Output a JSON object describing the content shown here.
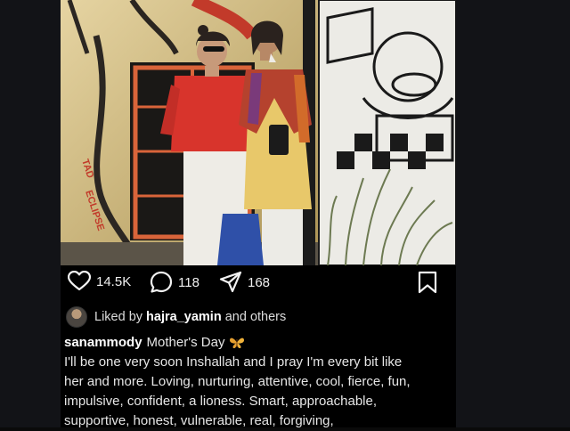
{
  "post": {
    "actions": {
      "likes": "14.5K",
      "comments": "118",
      "shares": "168"
    },
    "liked_by": {
      "prefix": "Liked by",
      "user": "hajra_yamin",
      "suffix": "and others"
    },
    "caption": {
      "username": "sanammody",
      "title": "Mother's Day",
      "emoji_icon": "butterfly-icon",
      "lines": [
        "I'll be one very soon Inshallah and I pray I'm every bit like",
        "her and more. Loving, nurturing, attentive, cool, fierce, fun,",
        "impulsive, confident, a lioness. Smart, approachable,",
        "supportive, honest, vulnerable, real, forgiving,"
      ]
    },
    "photo": {
      "wall_text": [
        "TAD",
        "ECLIPSE"
      ]
    }
  },
  "colors": {
    "background": "#000000",
    "side_panel": "#121317",
    "text": "#e6e6e6",
    "wall_yellow": "#d8bd70",
    "shirt_red": "#d8342c"
  }
}
